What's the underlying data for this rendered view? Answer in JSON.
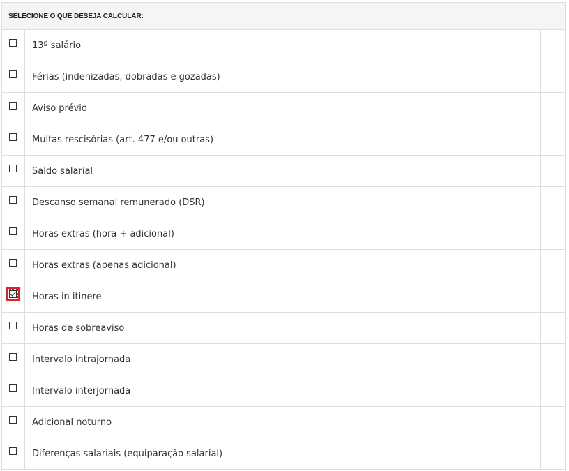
{
  "header": {
    "title": "SELECIONE O QUE DESEJA CALCULAR:"
  },
  "options": [
    {
      "label": "13º salário",
      "checked": false
    },
    {
      "label": "Férias (indenizadas, dobradas e gozadas)",
      "checked": false
    },
    {
      "label": "Aviso prévio",
      "checked": false
    },
    {
      "label": "Multas rescisórias (art. 477 e/ou outras)",
      "checked": false
    },
    {
      "label": "Saldo salarial",
      "checked": false
    },
    {
      "label": "Descanso semanal remunerado (DSR)",
      "checked": false
    },
    {
      "label": "Horas extras (hora + adicional)",
      "checked": false
    },
    {
      "label": "Horas extras (apenas adicional)",
      "checked": false
    },
    {
      "label": "Horas in itinere",
      "checked": true,
      "focused": true
    },
    {
      "label": "Horas de sobreaviso",
      "checked": false
    },
    {
      "label": "Intervalo intrajornada",
      "checked": false
    },
    {
      "label": "Intervalo interjornada",
      "checked": false
    },
    {
      "label": "Adicional noturno",
      "checked": false
    },
    {
      "label": "Diferenças salariais (equiparação salarial)",
      "checked": false
    }
  ],
  "colors": {
    "focus_highlight": "#e0202a",
    "border": "#dddddd",
    "header_bg": "#f5f5f5"
  }
}
